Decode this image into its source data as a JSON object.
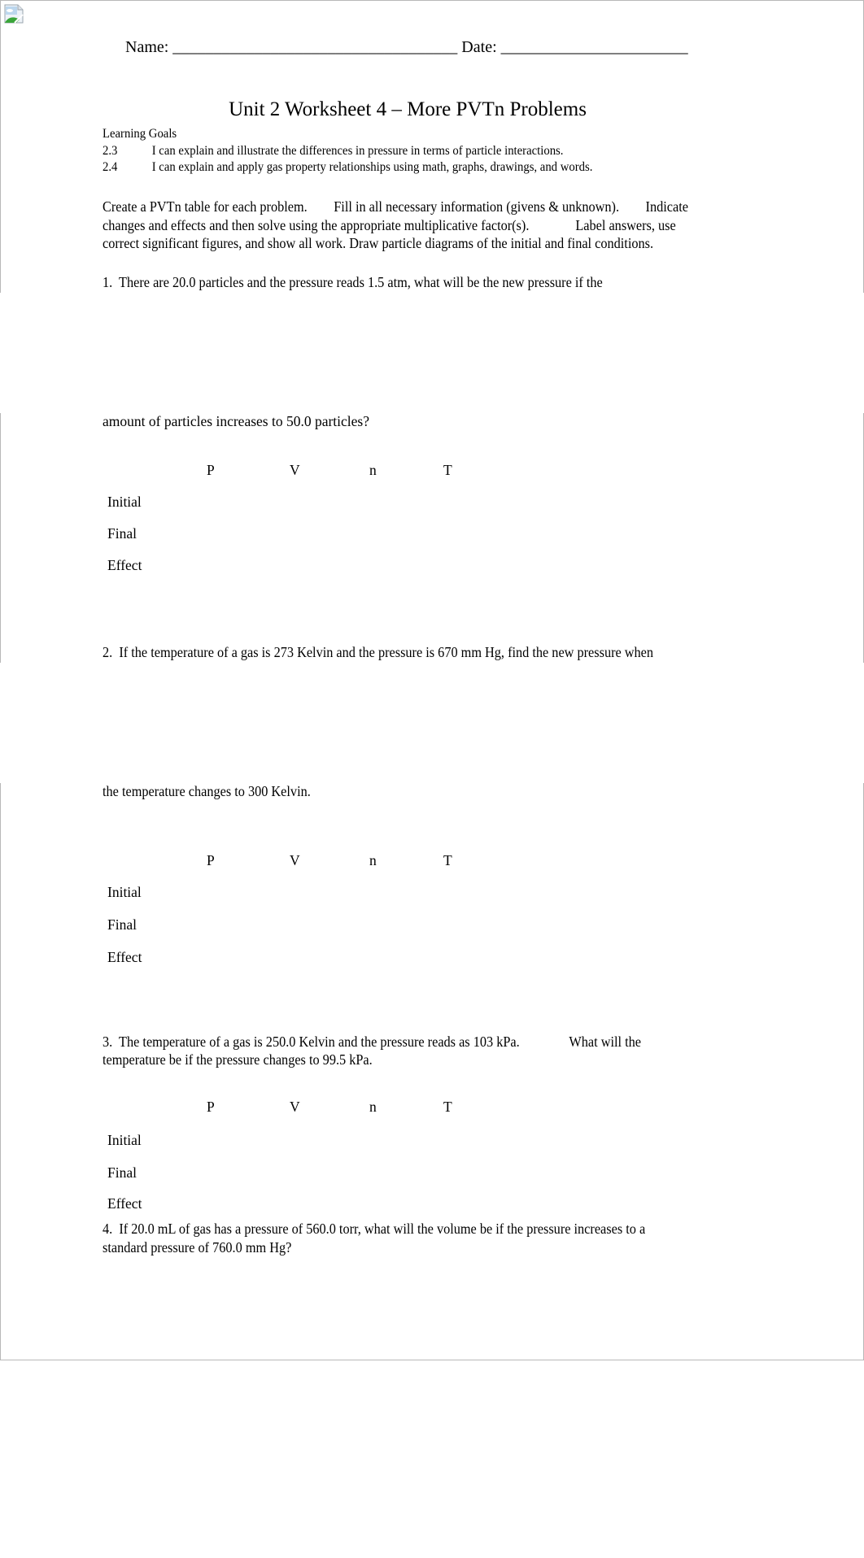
{
  "header": {
    "name_label": "Name: ___________________________________ Date: _______________________"
  },
  "title": "Unit 2 Worksheet 4 – More PVTn Problems",
  "learning_goals": {
    "label": "Learning Goals",
    "items": [
      {
        "number": "2.3",
        "text": "I can explain and illustrate the differences in pressure in terms of particle interactions."
      },
      {
        "number": "2.4",
        "text": "I can explain and apply gas property relationships using math, graphs, drawings, and words."
      }
    ]
  },
  "instructions": {
    "lines": [
      "Create a PVTn table for each problem.        Fill in all necessary information (givens & unknown).        Indicate",
      "changes and effects and then solve using the appropriate multiplicative factor(s).              Label answers, use",
      "correct significant figures, and show all work. Draw particle diagrams of the initial and final conditions."
    ]
  },
  "table": {
    "columns": [
      "P",
      "V",
      "n",
      "T"
    ],
    "rows": [
      "Initial",
      "Final",
      "Effect"
    ]
  },
  "questions": [
    {
      "lines": [
        "1.  There are 20.0 particles and the pressure reads 1.5 atm, what will be the new pressure if the",
        "amount of particles increases to 50.0 particles?"
      ]
    },
    {
      "lines": [
        "2.  If the temperature of a gas is 273 Kelvin and the pressure is 670 mm Hg, find the new pressure when",
        "the temperature changes to 300 Kelvin."
      ]
    },
    {
      "lines": [
        "3.  The temperature of a gas is 250.0 Kelvin and the pressure reads as 103 kPa.               What will the",
        "temperature be if the pressure changes to 99.5 kPa."
      ]
    },
    {
      "lines": [
        "4.  If 20.0 mL of gas has a pressure of 560.0 torr, what will the volume be if the pressure increases to a",
        "standard pressure of 760.0 mm Hg?"
      ]
    }
  ],
  "images": {
    "broken_image_icon": "broken-image-icon"
  }
}
